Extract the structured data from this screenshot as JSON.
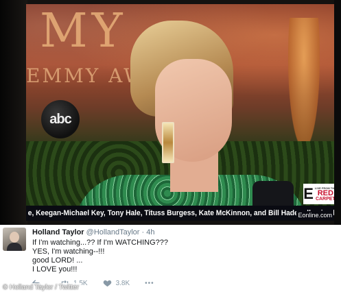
{
  "broadcast": {
    "backdrop_letters": "MY",
    "backdrop_awards": "EMMY AW",
    "network_logo": "abc",
    "ticker": "e, Keegan-Michael Key, Tony Hale, Tituss Burgess, Kate McKinnon, and Bill Hader all voiced roles in \"The Angr",
    "corner_bug_small": "LIVE FROM THE",
    "corner_bug_red": "RED",
    "corner_bug_carpet": "CARPET",
    "site": "Eonline.com"
  },
  "tweet": {
    "display_name": "Holland Taylor",
    "handle": "@HollandTaylor",
    "separator": "·",
    "time": "4h",
    "lines": [
      "If I'm watching...?? If I'm WATCHING???",
      "YES, I'm watching--!!!",
      "good LORD! ...",
      "I LOVE you!!!"
    ],
    "retweets": "1.5K",
    "likes": "3.8K",
    "more_icon": "•••"
  },
  "credit": "© Holland Taylor / Twitter",
  "colors": {
    "ticker_bg": "#0a0b12",
    "like_gray": "#8899a6",
    "handle_gray": "#657786",
    "red_carpet": "#c8102e"
  }
}
